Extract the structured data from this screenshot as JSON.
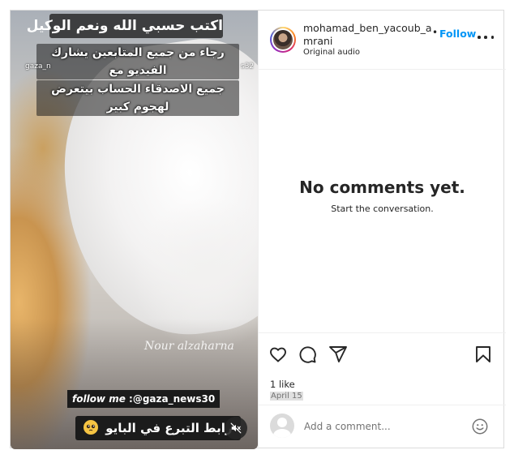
{
  "video": {
    "overlay_title": "اكتب حسبي الله ونعم الوكيل",
    "overlay_line1": "رجاء من جميع المتابعين يشارك الفيديو مع",
    "overlay_line2": "جميع الاصدقاء الحساب بيتعرض لهجوم كبير",
    "overlay_tag_left": "gaza_n",
    "overlay_tag_right": "s32",
    "watermark": "Nour alzaharna",
    "follow_me_prefix": "follow me",
    "follow_me_handle": " :@gaza_news30",
    "donate_text": "رابط التبرع في البايو",
    "mute_icon": "speaker-muted-icon"
  },
  "header": {
    "username": "mohamad_ben_yacoub_amrani",
    "separator": "•",
    "follow_label": "Follow",
    "audio_label": "Original audio",
    "more_icon": "more-horizontal-icon"
  },
  "comments": {
    "empty_title": "No comments yet.",
    "empty_subtitle": "Start the conversation."
  },
  "actions": {
    "like_icon": "heart-icon",
    "comment_icon": "comment-icon",
    "share_icon": "send-icon",
    "save_icon": "bookmark-icon",
    "likes_count": "1 like",
    "date": "April 15"
  },
  "add_comment": {
    "placeholder": "Add a comment...",
    "emoji_icon": "emoji-icon"
  },
  "colors": {
    "accent": "#0095f6",
    "text": "#262626",
    "muted": "#737373",
    "border": "#dbdbdb"
  }
}
